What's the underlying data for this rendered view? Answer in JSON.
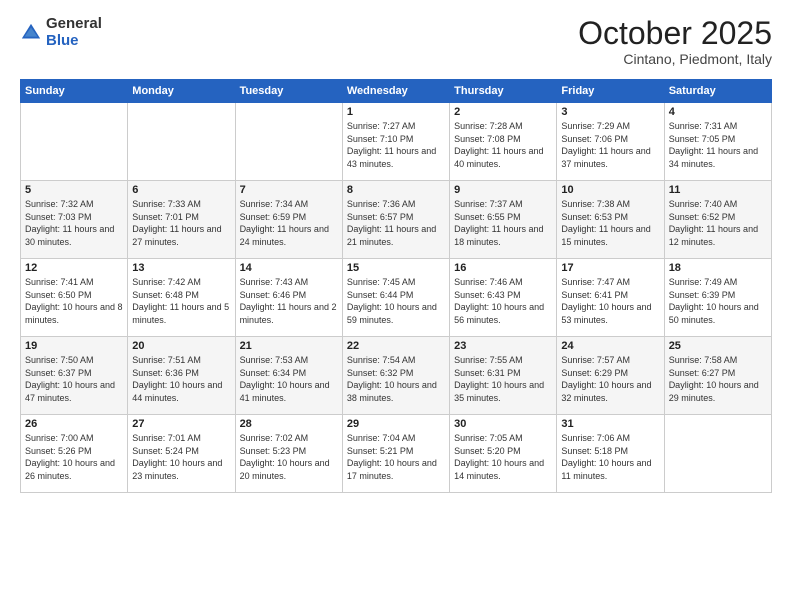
{
  "logo": {
    "general": "General",
    "blue": "Blue"
  },
  "header": {
    "month": "October 2025",
    "location": "Cintano, Piedmont, Italy"
  },
  "weekdays": [
    "Sunday",
    "Monday",
    "Tuesday",
    "Wednesday",
    "Thursday",
    "Friday",
    "Saturday"
  ],
  "weeks": [
    [
      {
        "day": "",
        "info": ""
      },
      {
        "day": "",
        "info": ""
      },
      {
        "day": "",
        "info": ""
      },
      {
        "day": "1",
        "sunrise": "7:27 AM",
        "sunset": "7:10 PM",
        "daylight": "11 hours and 43 minutes."
      },
      {
        "day": "2",
        "sunrise": "7:28 AM",
        "sunset": "7:08 PM",
        "daylight": "11 hours and 40 minutes."
      },
      {
        "day": "3",
        "sunrise": "7:29 AM",
        "sunset": "7:06 PM",
        "daylight": "11 hours and 37 minutes."
      },
      {
        "day": "4",
        "sunrise": "7:31 AM",
        "sunset": "7:05 PM",
        "daylight": "11 hours and 34 minutes."
      }
    ],
    [
      {
        "day": "5",
        "sunrise": "7:32 AM",
        "sunset": "7:03 PM",
        "daylight": "11 hours and 30 minutes."
      },
      {
        "day": "6",
        "sunrise": "7:33 AM",
        "sunset": "7:01 PM",
        "daylight": "11 hours and 27 minutes."
      },
      {
        "day": "7",
        "sunrise": "7:34 AM",
        "sunset": "6:59 PM",
        "daylight": "11 hours and 24 minutes."
      },
      {
        "day": "8",
        "sunrise": "7:36 AM",
        "sunset": "6:57 PM",
        "daylight": "11 hours and 21 minutes."
      },
      {
        "day": "9",
        "sunrise": "7:37 AM",
        "sunset": "6:55 PM",
        "daylight": "11 hours and 18 minutes."
      },
      {
        "day": "10",
        "sunrise": "7:38 AM",
        "sunset": "6:53 PM",
        "daylight": "11 hours and 15 minutes."
      },
      {
        "day": "11",
        "sunrise": "7:40 AM",
        "sunset": "6:52 PM",
        "daylight": "11 hours and 12 minutes."
      }
    ],
    [
      {
        "day": "12",
        "sunrise": "7:41 AM",
        "sunset": "6:50 PM",
        "daylight": "10 hours and 8 minutes."
      },
      {
        "day": "13",
        "sunrise": "7:42 AM",
        "sunset": "6:48 PM",
        "daylight": "11 hours and 5 minutes."
      },
      {
        "day": "14",
        "sunrise": "7:43 AM",
        "sunset": "6:46 PM",
        "daylight": "11 hours and 2 minutes."
      },
      {
        "day": "15",
        "sunrise": "7:45 AM",
        "sunset": "6:44 PM",
        "daylight": "10 hours and 59 minutes."
      },
      {
        "day": "16",
        "sunrise": "7:46 AM",
        "sunset": "6:43 PM",
        "daylight": "10 hours and 56 minutes."
      },
      {
        "day": "17",
        "sunrise": "7:47 AM",
        "sunset": "6:41 PM",
        "daylight": "10 hours and 53 minutes."
      },
      {
        "day": "18",
        "sunrise": "7:49 AM",
        "sunset": "6:39 PM",
        "daylight": "10 hours and 50 minutes."
      }
    ],
    [
      {
        "day": "19",
        "sunrise": "7:50 AM",
        "sunset": "6:37 PM",
        "daylight": "10 hours and 47 minutes."
      },
      {
        "day": "20",
        "sunrise": "7:51 AM",
        "sunset": "6:36 PM",
        "daylight": "10 hours and 44 minutes."
      },
      {
        "day": "21",
        "sunrise": "7:53 AM",
        "sunset": "6:34 PM",
        "daylight": "10 hours and 41 minutes."
      },
      {
        "day": "22",
        "sunrise": "7:54 AM",
        "sunset": "6:32 PM",
        "daylight": "10 hours and 38 minutes."
      },
      {
        "day": "23",
        "sunrise": "7:55 AM",
        "sunset": "6:31 PM",
        "daylight": "10 hours and 35 minutes."
      },
      {
        "day": "24",
        "sunrise": "7:57 AM",
        "sunset": "6:29 PM",
        "daylight": "10 hours and 32 minutes."
      },
      {
        "day": "25",
        "sunrise": "7:58 AM",
        "sunset": "6:27 PM",
        "daylight": "10 hours and 29 minutes."
      }
    ],
    [
      {
        "day": "26",
        "sunrise": "7:00 AM",
        "sunset": "5:26 PM",
        "daylight": "10 hours and 26 minutes."
      },
      {
        "day": "27",
        "sunrise": "7:01 AM",
        "sunset": "5:24 PM",
        "daylight": "10 hours and 23 minutes."
      },
      {
        "day": "28",
        "sunrise": "7:02 AM",
        "sunset": "5:23 PM",
        "daylight": "10 hours and 20 minutes."
      },
      {
        "day": "29",
        "sunrise": "7:04 AM",
        "sunset": "5:21 PM",
        "daylight": "10 hours and 17 minutes."
      },
      {
        "day": "30",
        "sunrise": "7:05 AM",
        "sunset": "5:20 PM",
        "daylight": "10 hours and 14 minutes."
      },
      {
        "day": "31",
        "sunrise": "7:06 AM",
        "sunset": "5:18 PM",
        "daylight": "10 hours and 11 minutes."
      },
      {
        "day": "",
        "info": ""
      }
    ]
  ]
}
